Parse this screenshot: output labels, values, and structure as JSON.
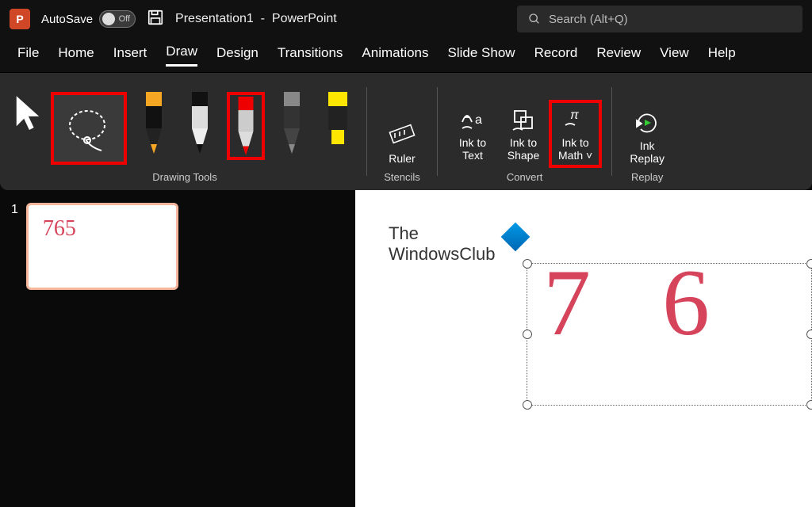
{
  "titlebar": {
    "autosave_label": "AutoSave",
    "autosave_state": "Off",
    "doc_name": "Presentation1",
    "app_name": "PowerPoint",
    "search_placeholder": "Search (Alt+Q)"
  },
  "tabs": [
    "File",
    "Home",
    "Insert",
    "Draw",
    "Design",
    "Transitions",
    "Animations",
    "Slide Show",
    "Record",
    "Review",
    "View",
    "Help"
  ],
  "active_tab": "Draw",
  "ribbon": {
    "drawing_tools_label": "Drawing Tools",
    "stencils_label": "Stencils",
    "convert_label": "Convert",
    "replay_label": "Replay",
    "ruler": "Ruler",
    "ink_to_text": "Ink to Text",
    "ink_to_shape": "Ink to Shape",
    "ink_to_math": "Ink to Math",
    "ink_replay": "Ink Replay"
  },
  "thumbs": {
    "num": "1",
    "ink": "765"
  },
  "slide": {
    "logo_line1": "The",
    "logo_line2": "WindowsClub",
    "ink": "7 6"
  }
}
